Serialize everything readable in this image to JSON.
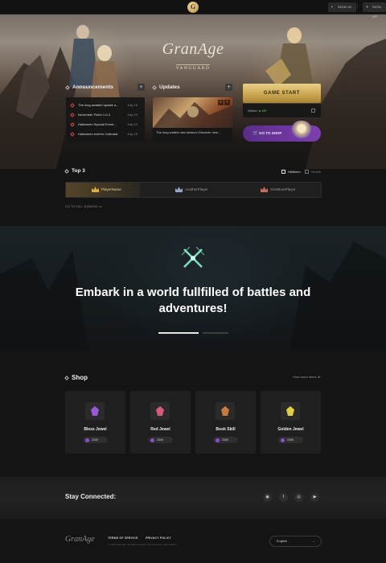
{
  "header": {
    "logo_letter": "G",
    "signin_label": "SIGN IN",
    "signup_label": "SIGN UP"
  },
  "hero": {
    "brand_main": "GranAge",
    "brand_sub": "VANGUARD"
  },
  "announcements": {
    "title": "Announcements",
    "plus": "+",
    "items": [
      {
        "title": "The long awaited update a...",
        "date": "July 19"
      },
      {
        "title": "November Patch 1.0.4",
        "date": "July 23"
      },
      {
        "title": "Halloween Special Event...",
        "date": "July 23"
      },
      {
        "title": "Halloween event's Calendar",
        "date": "July 19"
      }
    ]
  },
  "updates": {
    "title": "Updates",
    "plus": "+",
    "caption": "The long waited new season! Discover new...",
    "prev": "‹",
    "next": "›"
  },
  "play": {
    "game_start": "GAME START",
    "online_label": "Online:",
    "online_count": "● 387",
    "go_to_shop": "GO TO SHOP"
  },
  "top3": {
    "title": "Top 3",
    "tabs": [
      "Hellheim",
      "Nexilla"
    ],
    "players": [
      {
        "name": "PlayerName",
        "crown_color": "#d9b046"
      },
      {
        "name": "AnotherPlayer",
        "crown_color": "#8fa6c9"
      },
      {
        "name": "OneMorePlayer",
        "crown_color": "#c0705a"
      }
    ],
    "full_ranking": "GO TO FULL RANKING ≫"
  },
  "banner": {
    "title": "Embark in a world fullfilled of battles and adventures!",
    "emblem_color": "#7fe0c0"
  },
  "shop": {
    "title": "Shop",
    "view_more": "View more items ≫",
    "items": [
      {
        "name": "Bless Jewel",
        "price": "2340",
        "gem_color": "#9a5ad8"
      },
      {
        "name": "Red Jewel",
        "price": "2340",
        "gem_color": "#d85a7a"
      },
      {
        "name": "Book Skill",
        "price": "2340",
        "gem_color": "#c9793a"
      },
      {
        "name": "Golden Jewel",
        "price": "2340",
        "gem_color": "#e0d040"
      }
    ]
  },
  "social": {
    "title": "Stay Connected:",
    "icons": [
      "discord-icon",
      "facebook-icon",
      "instagram-icon",
      "youtube-icon"
    ],
    "glyphs": [
      "◉",
      "f",
      "◎",
      "▶"
    ]
  },
  "footer": {
    "logo": "GranAge",
    "terms": "TERMS OF SERVICE",
    "privacy": "PRIVACY POLICY",
    "copyright": "© 2023 GranAge. All rights belong to the respective right holders.",
    "language": "English",
    "language_chevron": "⌄"
  }
}
